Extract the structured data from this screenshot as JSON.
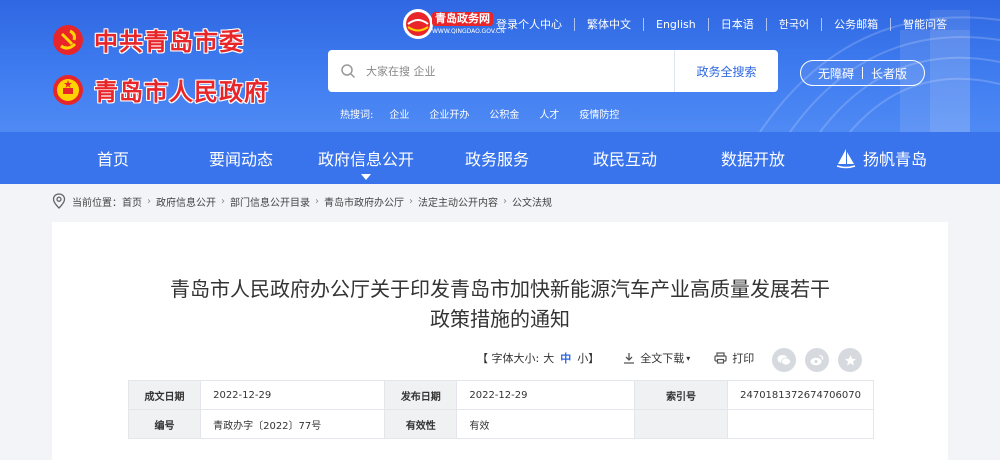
{
  "brand": {
    "party_committee": "中共青岛市委",
    "government": "青岛市人民政府"
  },
  "portal_logo": {
    "name": "青岛政务网",
    "url": "WWW.QINGDAO.GOV.CN"
  },
  "toplinks": [
    {
      "label": "登录个人中心"
    },
    {
      "label": "繁体中文"
    },
    {
      "label": "English"
    },
    {
      "label": "日本语"
    },
    {
      "label": "한국어"
    },
    {
      "label": "公务邮箱"
    },
    {
      "label": "智能问答"
    }
  ],
  "search": {
    "placeholder": "大家在搜 企业",
    "button": "政务全搜索"
  },
  "hot": {
    "label": "热搜词:",
    "items": [
      "企业",
      "企业开办",
      "公积金",
      "人才",
      "疫情防控"
    ]
  },
  "accessibility": {
    "barrier_free": "无障碍",
    "elderly": "长者版"
  },
  "nav": {
    "items": [
      {
        "label": "首页"
      },
      {
        "label": "要闻动态"
      },
      {
        "label": "政府信息公开"
      },
      {
        "label": "政务服务"
      },
      {
        "label": "政民互动"
      },
      {
        "label": "数据开放"
      },
      {
        "label": "扬帆青岛"
      }
    ],
    "active_index": 2
  },
  "breadcrumb": {
    "label": "当前位置：",
    "items": [
      "首页",
      "政府信息公开",
      "部门信息公开目录",
      "青岛市政府办公厅",
      "法定主动公开内容",
      "公文法规"
    ]
  },
  "article": {
    "title_line1": "青岛市人民政府办公厅关于印发青岛市加快新能源汽车产业高质量发展若干",
    "title_line2": "政策措施的通知",
    "font_size_label": "【 字体大小:",
    "font_large": "大",
    "font_medium": "中",
    "font_small": "小】",
    "download": "全文下载",
    "print": "打印"
  },
  "meta": {
    "row1": {
      "k1": "成文日期",
      "v1": "2022-12-29",
      "k2": "发布日期",
      "v2": "2022-12-29",
      "k3": "索引号",
      "v3": "2470181372674706070"
    },
    "row2": {
      "k1": "编号",
      "v1": "青政办字〔2022〕77号",
      "k2": "有效性",
      "v2": "有效",
      "k3": "",
      "v3": ""
    }
  },
  "colors": {
    "header_blue": "#2f67e2",
    "nav_blue": "#3a74ec",
    "brand_red": "#e8262a",
    "active_font": "#2f67e2"
  }
}
